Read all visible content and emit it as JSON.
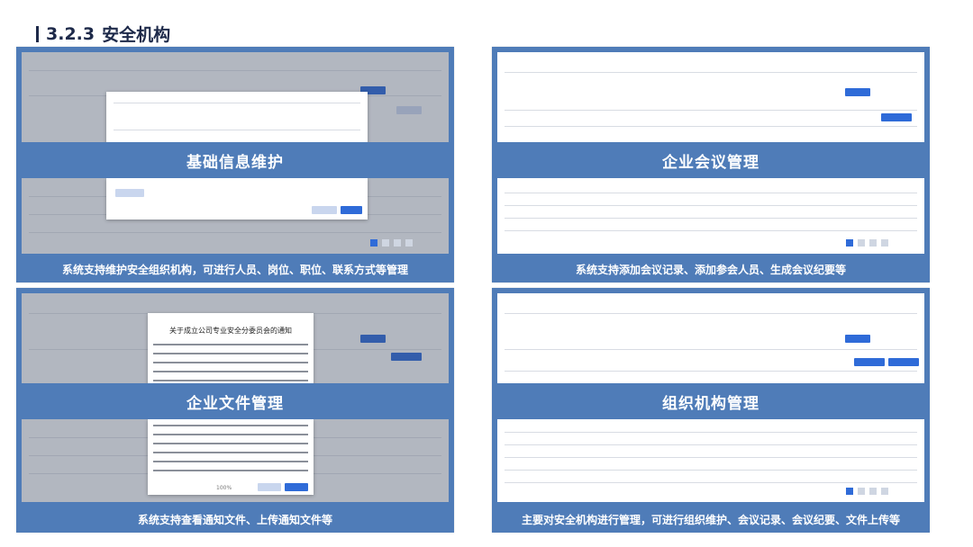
{
  "page": {
    "section_number": "3.2.3",
    "section_title": "安全机构"
  },
  "panels": [
    {
      "banner": "基础信息维护",
      "caption": "系统支持维护安全组织机构，可进行人员、岗位、职位、联系方式等管理"
    },
    {
      "banner": "企业会议管理",
      "caption": "系统支持添加会议记录、添加参会人员、生成会议纪要等"
    },
    {
      "banner": "企业文件管理",
      "caption": "系统支持查看通知文件、上传通知文件等"
    },
    {
      "banner": "组织机构管理",
      "caption": "主要对安全机构进行管理，可进行组织维护、会议记录、会议纪要、文件上传等"
    }
  ],
  "doc_preview": {
    "heading": "关于成立公司专业安全分委员会的通知",
    "zoom": "100%"
  },
  "colors": {
    "panel": "#4f7cb8",
    "accent": "#2f6bd8",
    "title": "#1e2a4a"
  }
}
